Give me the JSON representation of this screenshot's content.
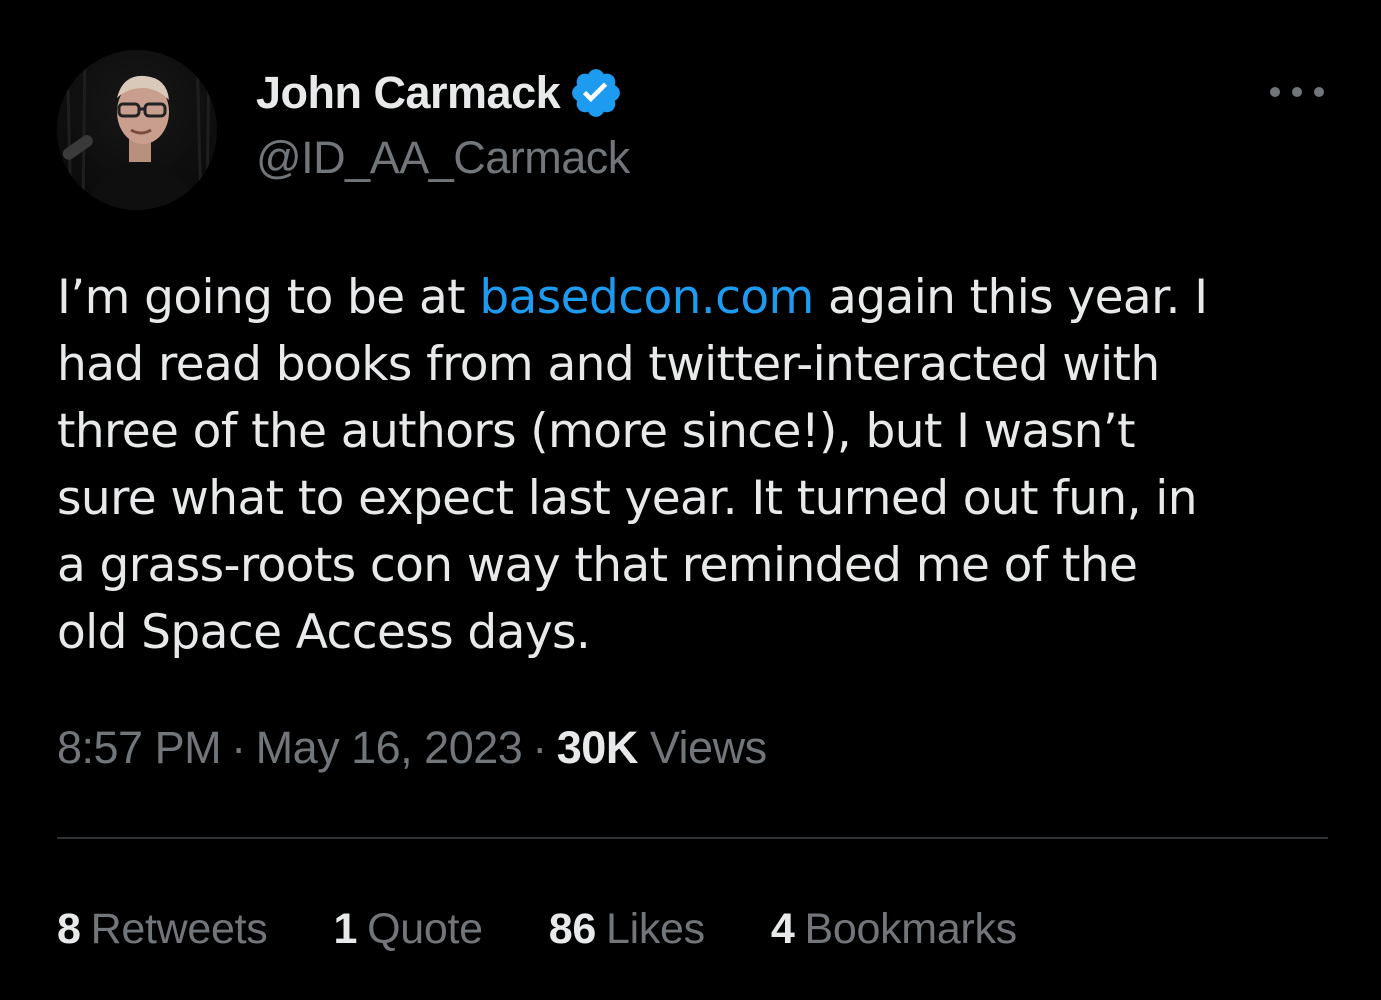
{
  "author": {
    "display_name": "John Carmack",
    "handle": "@ID_AA_Carmack",
    "avatar_icon": "profile-photo",
    "verified_icon": "verified-badge-icon",
    "verified_color": "#1d9bf0"
  },
  "menu": {
    "icon": "more-options-icon"
  },
  "tweet": {
    "lines": [
      {
        "before": "I’m going to be at ",
        "link": "basedcon.com",
        "after": " again this year. I"
      },
      {
        "before": "had read books from and twitter-interacted with"
      },
      {
        "before": "three of the authors (more since!), but I wasn’t"
      },
      {
        "before": "sure what to expect last year. It turned out fun, in"
      },
      {
        "before": "a grass-roots con way that reminded me of the"
      },
      {
        "before": "old Space Access days."
      }
    ],
    "link_color": "#1d9bf0"
  },
  "meta": {
    "time": "8:57 PM",
    "separator": "·",
    "date": "May 16, 2023",
    "views_count": "30K",
    "views_label": "Views"
  },
  "stats": [
    {
      "count": "8",
      "label": "Retweets"
    },
    {
      "count": "1",
      "label": "Quote"
    },
    {
      "count": "86",
      "label": "Likes"
    },
    {
      "count": "4",
      "label": "Bookmarks"
    }
  ],
  "colors": {
    "background": "#000000",
    "primary_text": "#e7e9ea",
    "secondary_text": "#71767b",
    "divider": "#2f3336"
  }
}
